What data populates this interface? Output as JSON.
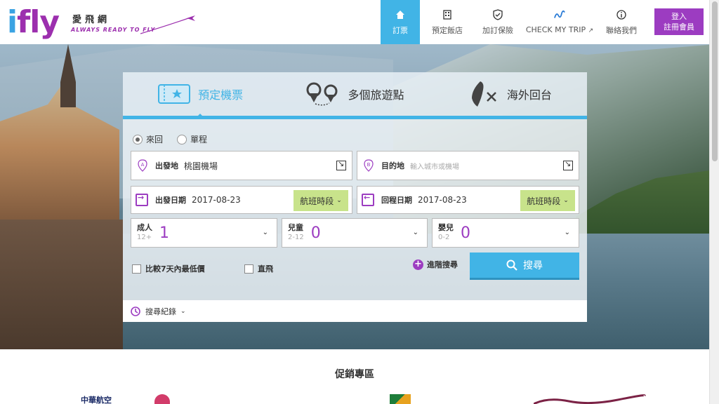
{
  "brand": {
    "logo_text": "ifly",
    "name_cn": "愛飛網",
    "tagline": "ALWAYS READY TO FLY"
  },
  "nav": {
    "items": [
      {
        "label": "訂票",
        "icon": "home-icon",
        "active": true
      },
      {
        "label": "預定飯店",
        "icon": "hotel-icon"
      },
      {
        "label": "加訂保險",
        "icon": "shield-icon"
      },
      {
        "label": "CHECK MY TRIP",
        "icon": "trip-icon"
      },
      {
        "label": "聯絡我們",
        "icon": "info-icon"
      }
    ],
    "login_line1": "登入",
    "login_line2": "註冊會員",
    "accent": "#41b4e6",
    "brand_purple": "#9c3cc1"
  },
  "tabs": [
    {
      "label": "預定機票",
      "icon": "ticket-icon",
      "active": true
    },
    {
      "label": "多個旅遊點",
      "icon": "map-pins-icon"
    },
    {
      "label": "海外回台",
      "icon": "taiwan-plane-icon"
    }
  ],
  "trip_type": {
    "round_trip": "來回",
    "one_way": "單程",
    "selected": "來回"
  },
  "origin": {
    "label": "出發地",
    "value": "桃園機場"
  },
  "destination": {
    "label": "目的地",
    "placeholder": "輸入城市或機場"
  },
  "depart": {
    "label": "出發日期",
    "value": "2017-08-23",
    "time_label": "航班時段"
  },
  "return": {
    "label": "回程日期",
    "value": "2017-08-23",
    "time_label": "航班時段"
  },
  "passengers": [
    {
      "label": "成人",
      "sub": "12+",
      "value": "1"
    },
    {
      "label": "兒童",
      "sub": "2-12",
      "value": "0"
    },
    {
      "label": "嬰兒",
      "sub": "0-2",
      "value": "0"
    }
  ],
  "options": {
    "compare_label": "比較7天內最低價",
    "direct_label": "直飛",
    "advanced_label": "進階搜尋",
    "search_label": "搜尋"
  },
  "history_label": "搜尋紀錄",
  "promo_title": "促銷專區",
  "partner_logos": [
    "中華航空",
    "長榮航空"
  ]
}
